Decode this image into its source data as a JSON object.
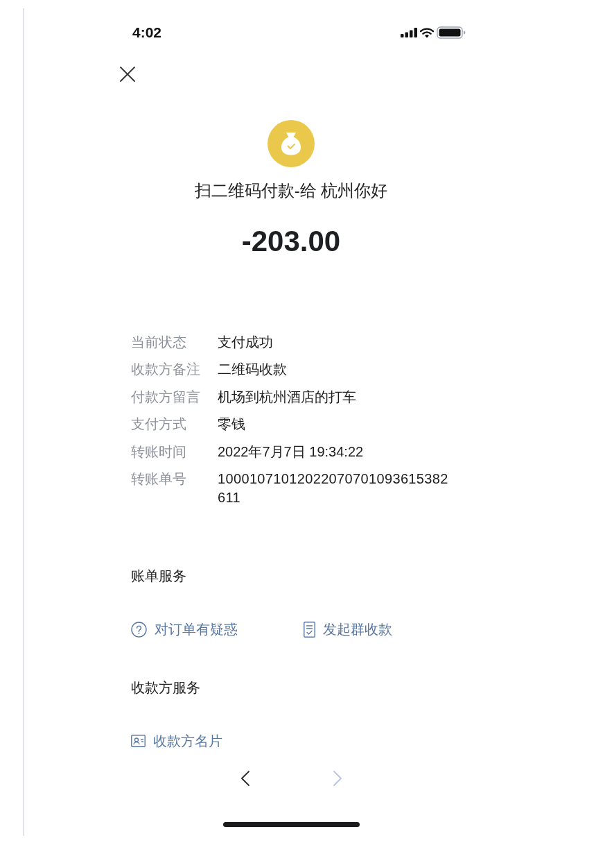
{
  "status_bar": {
    "time": "4:02"
  },
  "payment": {
    "title": "扫二维码付款-给 杭州你好",
    "amount": "-203.00"
  },
  "details": [
    {
      "label": "当前状态",
      "value": "支付成功"
    },
    {
      "label": "收款方备注",
      "value": "二维码收款"
    },
    {
      "label": "付款方留言",
      "value": "机场到杭州酒店的打车"
    },
    {
      "label": "支付方式",
      "value": "零钱"
    },
    {
      "label": "转账时间",
      "value": "2022年7月7日 19:34:22"
    },
    {
      "label": "转账单号",
      "value": "10001071012022070701093615382611"
    }
  ],
  "bill_services": {
    "heading": "账单服务",
    "items": [
      {
        "kind": "help",
        "label": "对订单有疑惑"
      },
      {
        "kind": "receipt",
        "label": "发起群收款"
      }
    ]
  },
  "payee_services": {
    "heading": "收款方服务",
    "items": [
      {
        "kind": "contact",
        "label": "收款方名片"
      }
    ]
  },
  "nav": {
    "back": {
      "disabled": false
    },
    "forward": {
      "disabled": true
    }
  }
}
